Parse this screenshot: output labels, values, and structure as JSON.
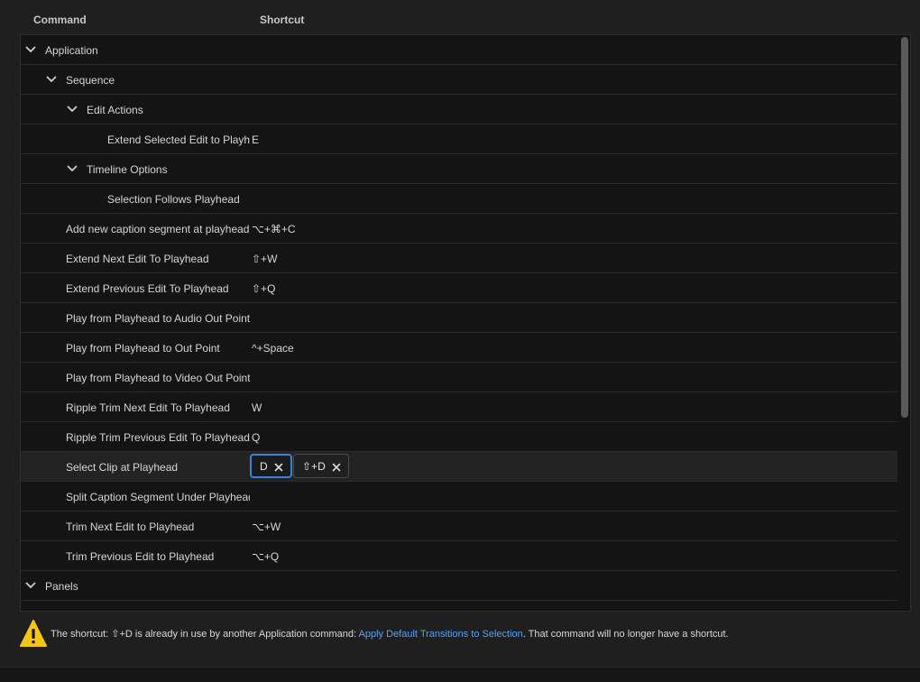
{
  "header": {
    "command_label": "Command",
    "shortcut_label": "Shortcut"
  },
  "rows": [
    {
      "label": "Application",
      "shortcut": "",
      "level": 0,
      "expanded": true
    },
    {
      "label": "Sequence",
      "shortcut": "",
      "level": 1,
      "expanded": true
    },
    {
      "label": "Edit Actions",
      "shortcut": "",
      "level": 2,
      "expanded": true
    },
    {
      "label": "Extend Selected Edit to Playhead",
      "shortcut": "E",
      "level": 3
    },
    {
      "label": "Timeline Options",
      "shortcut": "",
      "level": 2,
      "expanded": true
    },
    {
      "label": "Selection Follows Playhead",
      "shortcut": "",
      "level": 3
    },
    {
      "label": "Add new caption segment at playhead",
      "shortcut": "⌥+⌘+C",
      "level": 1
    },
    {
      "label": "Extend Next Edit To Playhead",
      "shortcut": "⇧+W",
      "level": 1
    },
    {
      "label": "Extend Previous Edit To Playhead",
      "shortcut": "⇧+Q",
      "level": 1
    },
    {
      "label": "Play from Playhead to Audio Out Point",
      "shortcut": "",
      "level": 1
    },
    {
      "label": "Play from Playhead to Out Point",
      "shortcut": "^+Space",
      "level": 1
    },
    {
      "label": "Play from Playhead to Video Out Point",
      "shortcut": "",
      "level": 1
    },
    {
      "label": "Ripple Trim Next Edit To Playhead",
      "shortcut": "W",
      "level": 1
    },
    {
      "label": "Ripple Trim Previous Edit To Playhead",
      "shortcut": "Q",
      "level": 1
    },
    {
      "label": "Select Clip at Playhead",
      "shortcut": "",
      "level": 1,
      "selected": true
    },
    {
      "label": "Split Caption Segment Under Playhead",
      "shortcut": "",
      "level": 1
    },
    {
      "label": "Trim Next Edit to Playhead",
      "shortcut": "⌥+W",
      "level": 1
    },
    {
      "label": "Trim Previous Edit to Playhead",
      "shortcut": "⌥+Q",
      "level": 1
    },
    {
      "label": "Panels",
      "shortcut": "",
      "level": 0,
      "expanded": true
    }
  ],
  "selected_chips": [
    {
      "label": "D",
      "active": true
    },
    {
      "label": "⇧+D",
      "active": false
    }
  ],
  "warning": {
    "prefix": "The shortcut: ⇧+D is already in use by another Application command: ",
    "link": "Apply Default Transitions to Selection",
    "suffix": ". That command will no longer have a shortcut."
  },
  "colors": {
    "accent": "#3b82d6",
    "link": "#5aa0f0",
    "warning": "#f5c518"
  }
}
